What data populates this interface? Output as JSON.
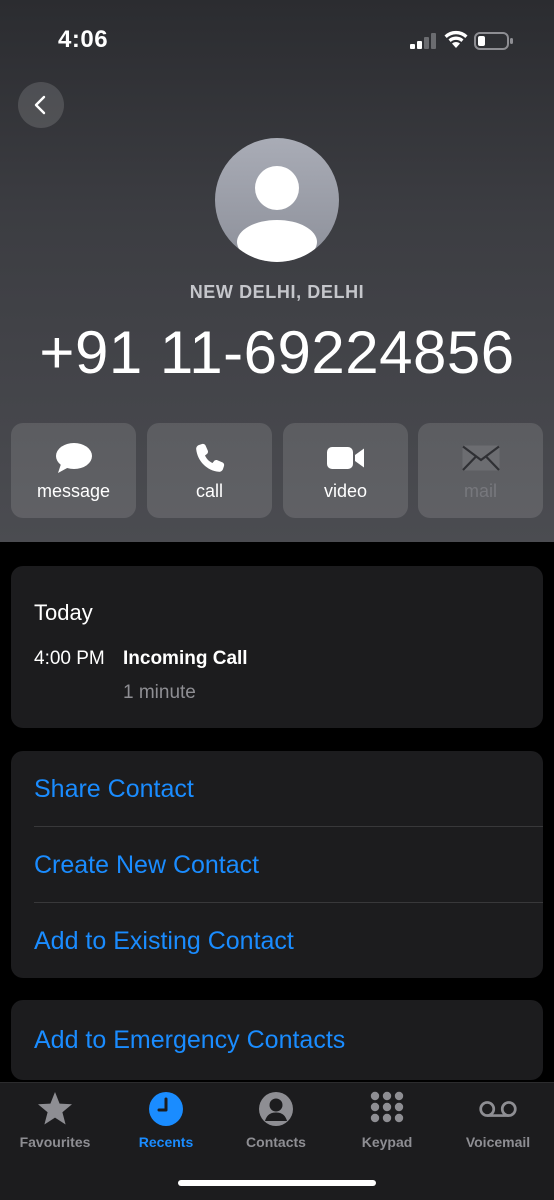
{
  "status_bar": {
    "time": "4:06"
  },
  "contact": {
    "location": "NEW DELHI, DELHI",
    "number": "+91 11-69224856"
  },
  "actions": [
    {
      "label": "message",
      "icon": "message-bubble-icon",
      "enabled": true
    },
    {
      "label": "call",
      "icon": "phone-icon",
      "enabled": true
    },
    {
      "label": "video",
      "icon": "video-camera-icon",
      "enabled": true
    },
    {
      "label": "mail",
      "icon": "envelope-icon",
      "enabled": false
    }
  ],
  "call_history": {
    "day": "Today",
    "entries": [
      {
        "time": "4:00 PM",
        "type": "Incoming Call",
        "duration": "1 minute"
      }
    ]
  },
  "options": [
    {
      "label": "Share Contact"
    },
    {
      "label": "Create New Contact"
    },
    {
      "label": "Add to Existing Contact"
    }
  ],
  "emergency": {
    "label": "Add to Emergency Contacts"
  },
  "tab_bar": {
    "tabs": [
      {
        "label": "Favourites",
        "icon": "star-icon",
        "active": false
      },
      {
        "label": "Recents",
        "icon": "clock-icon",
        "active": true
      },
      {
        "label": "Contacts",
        "icon": "person-circle-icon",
        "active": false
      },
      {
        "label": "Keypad",
        "icon": "keypad-icon",
        "active": false
      },
      {
        "label": "Voicemail",
        "icon": "voicemail-icon",
        "active": false
      }
    ]
  },
  "colors": {
    "accent": "#1a8cff",
    "card_background": "#1c1c1e",
    "secondary_text": "#8e8e93"
  }
}
